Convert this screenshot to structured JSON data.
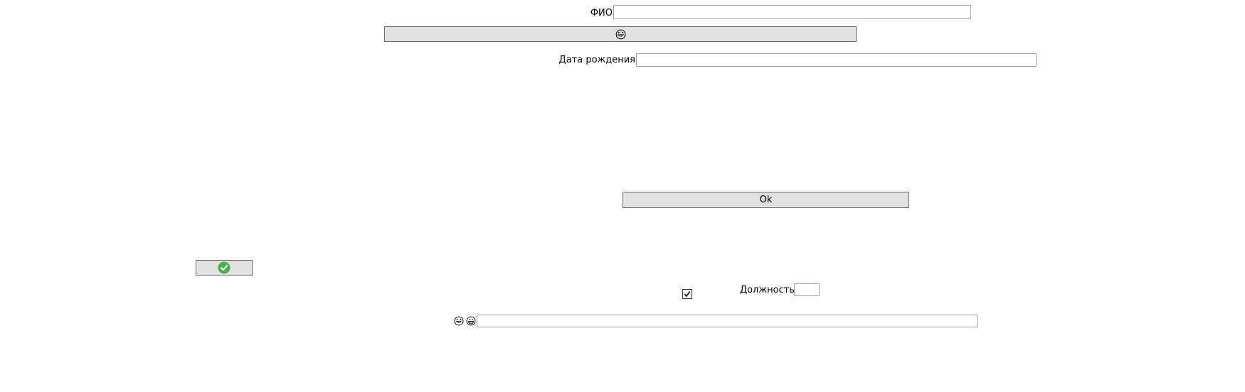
{
  "form": {
    "fio_label": "ФИО",
    "fio_value": "",
    "emoji_button_icon": "laughing-face-icon",
    "birthdate_label": "Дата рождения",
    "birthdate_value": "",
    "ok_label": "Ok",
    "confirm_button_icon": "green-check-circle-icon",
    "checkbox_checked": true,
    "position_label": "Должность",
    "position_value": "",
    "bottom_icons": [
      "laughing-face-icon",
      "grinning-face-icon"
    ],
    "bottom_value": ""
  },
  "colors": {
    "button_bg": "#e1e1e1",
    "button_border": "#6b6b6b",
    "field_border": "#a6a6a6",
    "check_green": "#4caf50"
  }
}
